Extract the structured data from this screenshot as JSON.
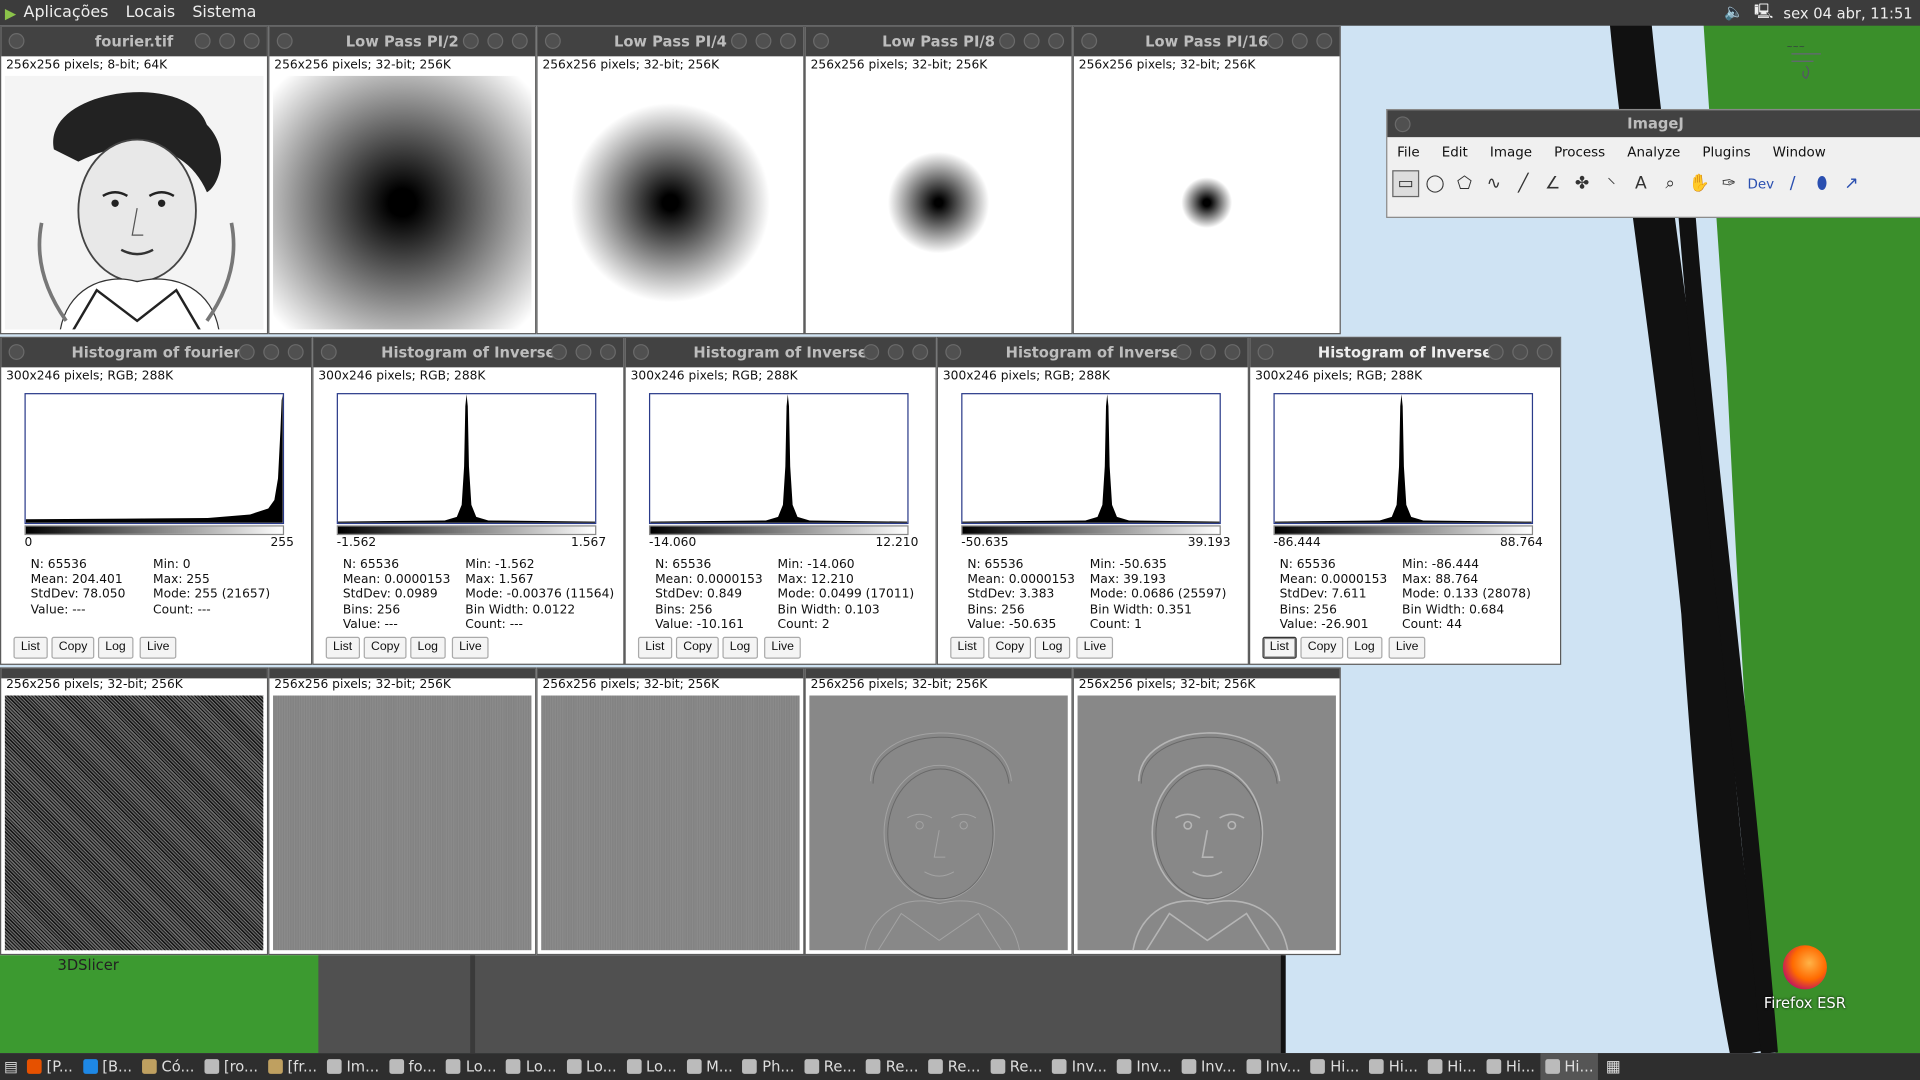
{
  "top_panel": {
    "menus": [
      "Aplicações",
      "Locais",
      "Sistema"
    ],
    "clock": "sex 04 abr, 11:51"
  },
  "row1": [
    {
      "title": "fourier.tif",
      "info": "256x256 pixels; 8-bit; 64K",
      "kind": "portrait"
    },
    {
      "title": "Low Pass PI/2",
      "info": "256x256 pixels; 32-bit; 256K",
      "kind": "lowpass",
      "level": 0.95
    },
    {
      "title": "Low Pass PI/4",
      "info": "256x256 pixels; 32-bit; 256K",
      "kind": "lowpass",
      "level": 0.55
    },
    {
      "title": "Low Pass PI/8",
      "info": "256x256 pixels; 32-bit; 256K",
      "kind": "lowpass",
      "level": 0.28
    },
    {
      "title": "Low Pass PI/16",
      "info": "256x256 pixels; 32-bit; 256K",
      "kind": "lowpass",
      "level": 0.14
    }
  ],
  "histograms": [
    {
      "title": "Histogram of fourier",
      "info": "300x246 pixels; RGB; 288K",
      "xmin": "0",
      "xmax": "255",
      "left": [
        "N: 65536",
        "Mean: 204.401",
        "StdDev: 78.050",
        "Value: ---"
      ],
      "right": [
        "Min: 0",
        "Max: 255",
        "Mode: 255 (21657)",
        "Count: ---"
      ],
      "shape": "ramp",
      "peak": 1.0
    },
    {
      "title": "Histogram of Inverse",
      "info": "300x246 pixels; RGB; 288K",
      "xmin": "-1.562",
      "xmax": "1.567",
      "left": [
        "N: 65536",
        "Mean: 0.0000153",
        "StdDev: 0.0989",
        "Bins: 256",
        "Value: ---"
      ],
      "right": [
        "Min: -1.562",
        "Max: 1.567",
        "Mode: -0.00376 (11564)",
        "Bin Width: 0.0122",
        "Count: ---"
      ],
      "shape": "spike",
      "peak": 0.5
    },
    {
      "title": "Histogram of Inverse",
      "info": "300x246 pixels; RGB; 288K",
      "xmin": "-14.060",
      "xmax": "12.210",
      "left": [
        "N: 65536",
        "Mean: 0.0000153",
        "StdDev: 0.849",
        "Bins: 256",
        "Value: -10.161"
      ],
      "right": [
        "Min: -14.060",
        "Max: 12.210",
        "Mode: 0.0499 (17011)",
        "Bin Width: 0.103",
        "Count: 2"
      ],
      "shape": "spike",
      "peak": 0.535
    },
    {
      "title": "Histogram of Inverse",
      "info": "300x246 pixels; RGB; 288K",
      "xmin": "-50.635",
      "xmax": "39.193",
      "left": [
        "N: 65536",
        "Mean: 0.0000153",
        "StdDev: 3.383",
        "Bins: 256",
        "Value: -50.635"
      ],
      "right": [
        "Min: -50.635",
        "Max: 39.193",
        "Mode: 0.0686 (25597)",
        "Bin Width: 0.351",
        "Count: 1"
      ],
      "shape": "spike",
      "peak": 0.563
    },
    {
      "title": "Histogram of Inverse",
      "info": "300x246 pixels; RGB; 288K",
      "xmin": "-86.444",
      "xmax": "88.764",
      "left": [
        "N: 65536",
        "Mean: 0.0000153",
        "StdDev: 7.611",
        "Bins: 256",
        "Value: -26.901"
      ],
      "right": [
        "Min: -86.444",
        "Max: 88.764",
        "Mode: 0.133 (28078)",
        "Bin Width: 0.684",
        "Count: 44"
      ],
      "shape": "spike",
      "peak": 0.493,
      "active": true
    }
  ],
  "hist_buttons": [
    "List",
    "Copy",
    "Log",
    "Live"
  ],
  "row3": [
    {
      "info": "256x256 pixels; 32-bit; 256K",
      "kind": "noise"
    },
    {
      "info": "256x256 pixels; 32-bit; 256K",
      "kind": "flat"
    },
    {
      "info": "256x256 pixels; 32-bit; 256K",
      "kind": "flat2"
    },
    {
      "info": "256x256 pixels; 32-bit; 256K",
      "kind": "edge1"
    },
    {
      "info": "256x256 pixels; 32-bit; 256K",
      "kind": "edge2"
    }
  ],
  "imagej": {
    "title": "ImageJ",
    "menu": [
      "File",
      "Edit",
      "Image",
      "Process",
      "Analyze",
      "Plugins",
      "Window"
    ],
    "tools": [
      "rectangle-tool-icon",
      "oval-tool-icon",
      "polygon-tool-icon",
      "freehand-tool-icon",
      "line-tool-icon",
      "angle-tool-icon",
      "point-tool-icon",
      "wand-tool-icon",
      "text-tool-icon",
      "magnifier-tool-icon",
      "hand-tool-icon",
      "color-picker-icon",
      "dev-tool-icon",
      "brush-tool-icon",
      "flood-fill-icon",
      "pipette-icon"
    ],
    "dev_label": "Dev"
  },
  "desktop_icons": {
    "slicer": "3DSlicer",
    "firefox": "Firefox ESR"
  },
  "taskbar": [
    "[P...",
    "[B...",
    "Có...",
    "[ro...",
    "[fr...",
    "Im...",
    "fo...",
    "Lo...",
    "Lo...",
    "Lo...",
    "Lo...",
    "M...",
    "Ph...",
    "Re...",
    "Re...",
    "Re...",
    "Re...",
    "Inv...",
    "Inv...",
    "Inv...",
    "Inv...",
    "Hi...",
    "Hi...",
    "Hi...",
    "Hi...",
    "Hi..."
  ]
}
